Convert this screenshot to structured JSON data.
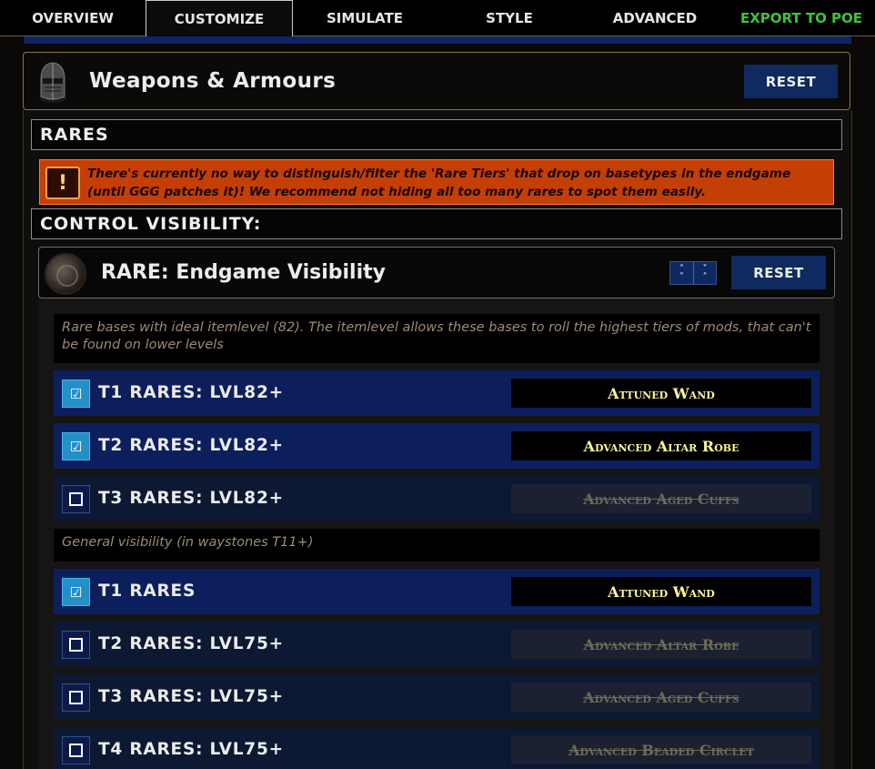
{
  "tabs": [
    {
      "label": "OVERVIEW",
      "active": false
    },
    {
      "label": "CUSTOMIZE",
      "active": true
    },
    {
      "label": "SIMULATE",
      "active": false
    },
    {
      "label": "STYLE",
      "active": false
    },
    {
      "label": "ADVANCED",
      "active": false
    },
    {
      "label": "EXPORT TO POE",
      "active": false,
      "color": "#3fc43a"
    }
  ],
  "panel": {
    "icon": "helmet-icon",
    "title": "Weapons & Armours",
    "reset_label": "RESET"
  },
  "sections": {
    "rares": "RARES",
    "control_visibility": "CONTROL VISIBILITY:"
  },
  "warning": {
    "icon": "exclamation-icon",
    "text": "There's currently no way to distinguish/filter the 'Rare Tiers' that drop on basetypes in the endgame (until GGG patches it)! We recommend not hiding all too many rares to spot them easily."
  },
  "card": {
    "icon": "rare-orb-icon",
    "title": "RARE: Endgame Visibility",
    "reset_label": "RESET",
    "desc_ideal": "Rare bases with ideal itemlevel (82). The itemlevel allows these bases to roll the highest tiers of mods, that can't be found on lower levels",
    "desc_general": "General visibility (in waystones T11+)"
  },
  "rules": [
    {
      "label": "T1 RARES: LVL82+",
      "enabled": true,
      "preview": "Attuned Wand"
    },
    {
      "label": "T2 RARES: LVL82+",
      "enabled": true,
      "preview": "Advanced Altar Robe"
    },
    {
      "label": "T3 RARES: LVL82+",
      "enabled": false,
      "preview": "Advanced Aged Cuffs"
    },
    {
      "label": "T1 RARES",
      "enabled": true,
      "preview": "Attuned Wand"
    },
    {
      "label": "T2 RARES: LVL75+",
      "enabled": false,
      "preview": "Advanced Altar Robe"
    },
    {
      "label": "T3 RARES: LVL75+",
      "enabled": false,
      "preview": "Advanced Aged Cuffs"
    },
    {
      "label": "T4 RARES: LVL75+",
      "enabled": false,
      "preview": "Advanced Beaded Circlet"
    }
  ],
  "colors": {
    "accent_blue": "#0e2a5e",
    "checkbox_on": "#2391c8",
    "warning_bg": "#c43f06",
    "preview_text": "#fdf69a",
    "export_green": "#3fc43a"
  }
}
